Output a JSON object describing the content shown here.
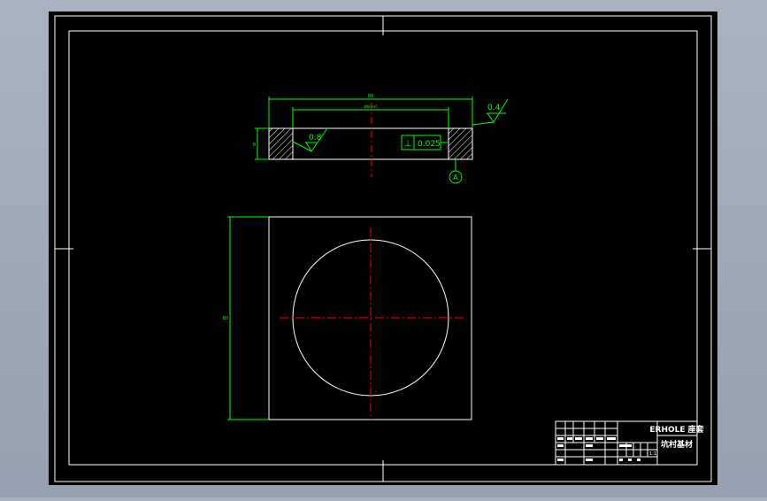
{
  "drawing": {
    "background_color": "#000000",
    "line_color": "#ffffff",
    "dimension_color": "#00ff00",
    "centerline_color": "#ff0000",
    "annotation_color": "#00ff00"
  },
  "section_view": {
    "overall_dim": "80",
    "inner_dim": "Ø60 H7",
    "height_dim": "8",
    "roughness_inner": "0.8",
    "roughness_outer": "0.4",
    "tolerance_value": "0.025",
    "tolerance_symbol": "⊥",
    "datum_label": "A"
  },
  "plan_view": {
    "height_dim": "80"
  },
  "title_block": {
    "part_name": "ERHOLE 座套",
    "drawing_number": "坑村基材",
    "scale_label": "1:1"
  }
}
